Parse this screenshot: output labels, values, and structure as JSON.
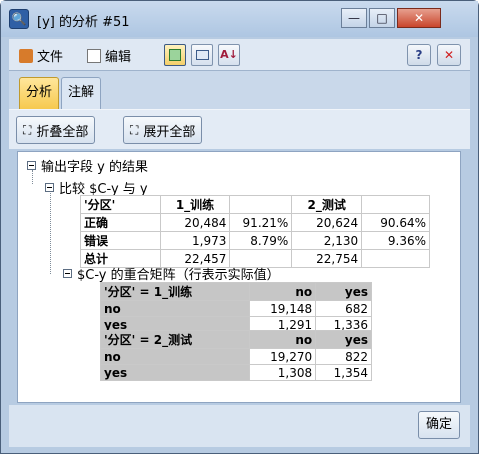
{
  "window": {
    "title": "[y] 的分析 #51",
    "min_glyph": "—",
    "max_glyph": "□",
    "close_glyph": "✕"
  },
  "menu": {
    "file": "文件",
    "edit": "编辑"
  },
  "toolbar": {
    "help_glyph": "?",
    "close_glyph": "✕"
  },
  "tabs": [
    {
      "label": "分析"
    },
    {
      "label": "注解"
    }
  ],
  "actions": {
    "collapse": "折叠全部",
    "expand": "展开全部"
  },
  "tree": {
    "root": "输出字段 y 的结果",
    "compare": "比较 $C-y 与 y",
    "matrix": "$C-y 的重合矩阵（行表示实际值）"
  },
  "summary": {
    "header": [
      "'分区'",
      "1_训练",
      "",
      "2_测试",
      ""
    ],
    "rows": [
      [
        "正确",
        "20,484",
        "91.21%",
        "20,624",
        "90.64%"
      ],
      [
        "错误",
        "1,973",
        "8.79%",
        "2,130",
        "9.36%"
      ],
      [
        "总计",
        "22,457",
        "",
        "22,754",
        ""
      ]
    ]
  },
  "matrix_train": {
    "header": [
      "'分区' = 1_训练",
      "no",
      "yes"
    ],
    "rows": [
      [
        "no",
        "19,148",
        "682"
      ],
      [
        "yes",
        "1,291",
        "1,336"
      ]
    ]
  },
  "matrix_test": {
    "header": [
      "'分区' = 2_测试",
      "no",
      "yes"
    ],
    "rows": [
      [
        "no",
        "19,270",
        "822"
      ],
      [
        "yes",
        "1,308",
        "1,354"
      ]
    ]
  },
  "footer": {
    "ok": "确定"
  }
}
